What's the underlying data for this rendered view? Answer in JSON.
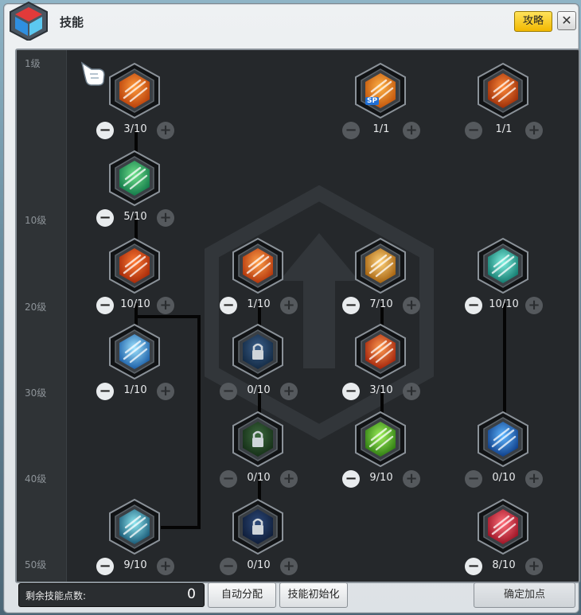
{
  "window": {
    "title": "技能",
    "guide_label": "攻略",
    "close_label": "✕"
  },
  "levels": [
    "1级",
    "10级",
    "20级",
    "30级",
    "40级",
    "50级"
  ],
  "skills": [
    {
      "id": "s1",
      "count": "3/10",
      "minus_enabled": true,
      "icon": "triple-slash-skill-icon",
      "colors": [
        "#ff9a3c",
        "#b8400a"
      ]
    },
    {
      "id": "s2",
      "count": "1/1",
      "minus_enabled": false,
      "sp": true,
      "sp_label": "SP",
      "icon": "crosshair-skill-icon",
      "colors": [
        "#ffb347",
        "#c2560c"
      ]
    },
    {
      "id": "s3",
      "count": "1/1",
      "minus_enabled": false,
      "icon": "beast-strike-skill-icon",
      "colors": [
        "#ff8a3a",
        "#9c2e08"
      ]
    },
    {
      "id": "s4",
      "count": "5/10",
      "minus_enabled": true,
      "icon": "wind-arrows-skill-icon",
      "colors": [
        "#6fe08a",
        "#137a4a"
      ]
    },
    {
      "id": "s5",
      "count": "10/10",
      "minus_enabled": true,
      "icon": "fire-arrow-skill-icon",
      "colors": [
        "#ff7a33",
        "#a52a0a"
      ]
    },
    {
      "id": "s6",
      "count": "1/10",
      "minus_enabled": true,
      "icon": "arrow-rain-skill-icon",
      "colors": [
        "#ffa04a",
        "#b3360c"
      ]
    },
    {
      "id": "s7",
      "count": "7/10",
      "minus_enabled": true,
      "icon": "eagle-skill-icon",
      "colors": [
        "#ffd27a",
        "#a5620f"
      ]
    },
    {
      "id": "s8",
      "count": "10/10",
      "minus_enabled": true,
      "icon": "spirit-body-skill-icon",
      "colors": [
        "#7ff0e0",
        "#137a6e"
      ]
    },
    {
      "id": "s9",
      "count": "1/10",
      "minus_enabled": true,
      "icon": "ice-arrows-skill-icon",
      "colors": [
        "#9fe4ff",
        "#1b5fa8"
      ]
    },
    {
      "id": "s10",
      "count": "0/10",
      "minus_enabled": false,
      "locked": true,
      "icon": "lock-icon",
      "colors": [
        "#3b5f8a",
        "#132a44"
      ]
    },
    {
      "id": "s11",
      "count": "3/10",
      "minus_enabled": true,
      "icon": "flame-dash-skill-icon",
      "colors": [
        "#ff9a50",
        "#a3240c"
      ]
    },
    {
      "id": "s12",
      "count": "0/10",
      "minus_enabled": false,
      "locked": true,
      "icon": "lock-icon",
      "colors": [
        "#3d6a3f",
        "#163018"
      ]
    },
    {
      "id": "s13",
      "count": "9/10",
      "minus_enabled": true,
      "icon": "green-spiral-skill-icon",
      "colors": [
        "#9df05a",
        "#2f7d12"
      ]
    },
    {
      "id": "s14",
      "count": "0/10",
      "minus_enabled": false,
      "icon": "gear-burst-skill-icon",
      "colors": [
        "#5fb6ff",
        "#0f3f8a"
      ]
    },
    {
      "id": "s15",
      "count": "9/10",
      "minus_enabled": true,
      "icon": "drill-arrow-skill-icon",
      "colors": [
        "#8ee7f0",
        "#1a5b78"
      ]
    },
    {
      "id": "s16",
      "count": "0/10",
      "minus_enabled": false,
      "locked": true,
      "icon": "lock-icon",
      "colors": [
        "#2e4a7a",
        "#0f1e3a"
      ]
    },
    {
      "id": "s17",
      "count": "8/10",
      "minus_enabled": true,
      "icon": "red-crystal-skill-icon",
      "colors": [
        "#ff6f7a",
        "#9c1426"
      ]
    }
  ],
  "footer": {
    "points_label": "剩余技能点数:",
    "points_value": "0",
    "auto_label": "自动分配",
    "reset_label": "技能初始化",
    "confirm_label": "确定加点"
  }
}
